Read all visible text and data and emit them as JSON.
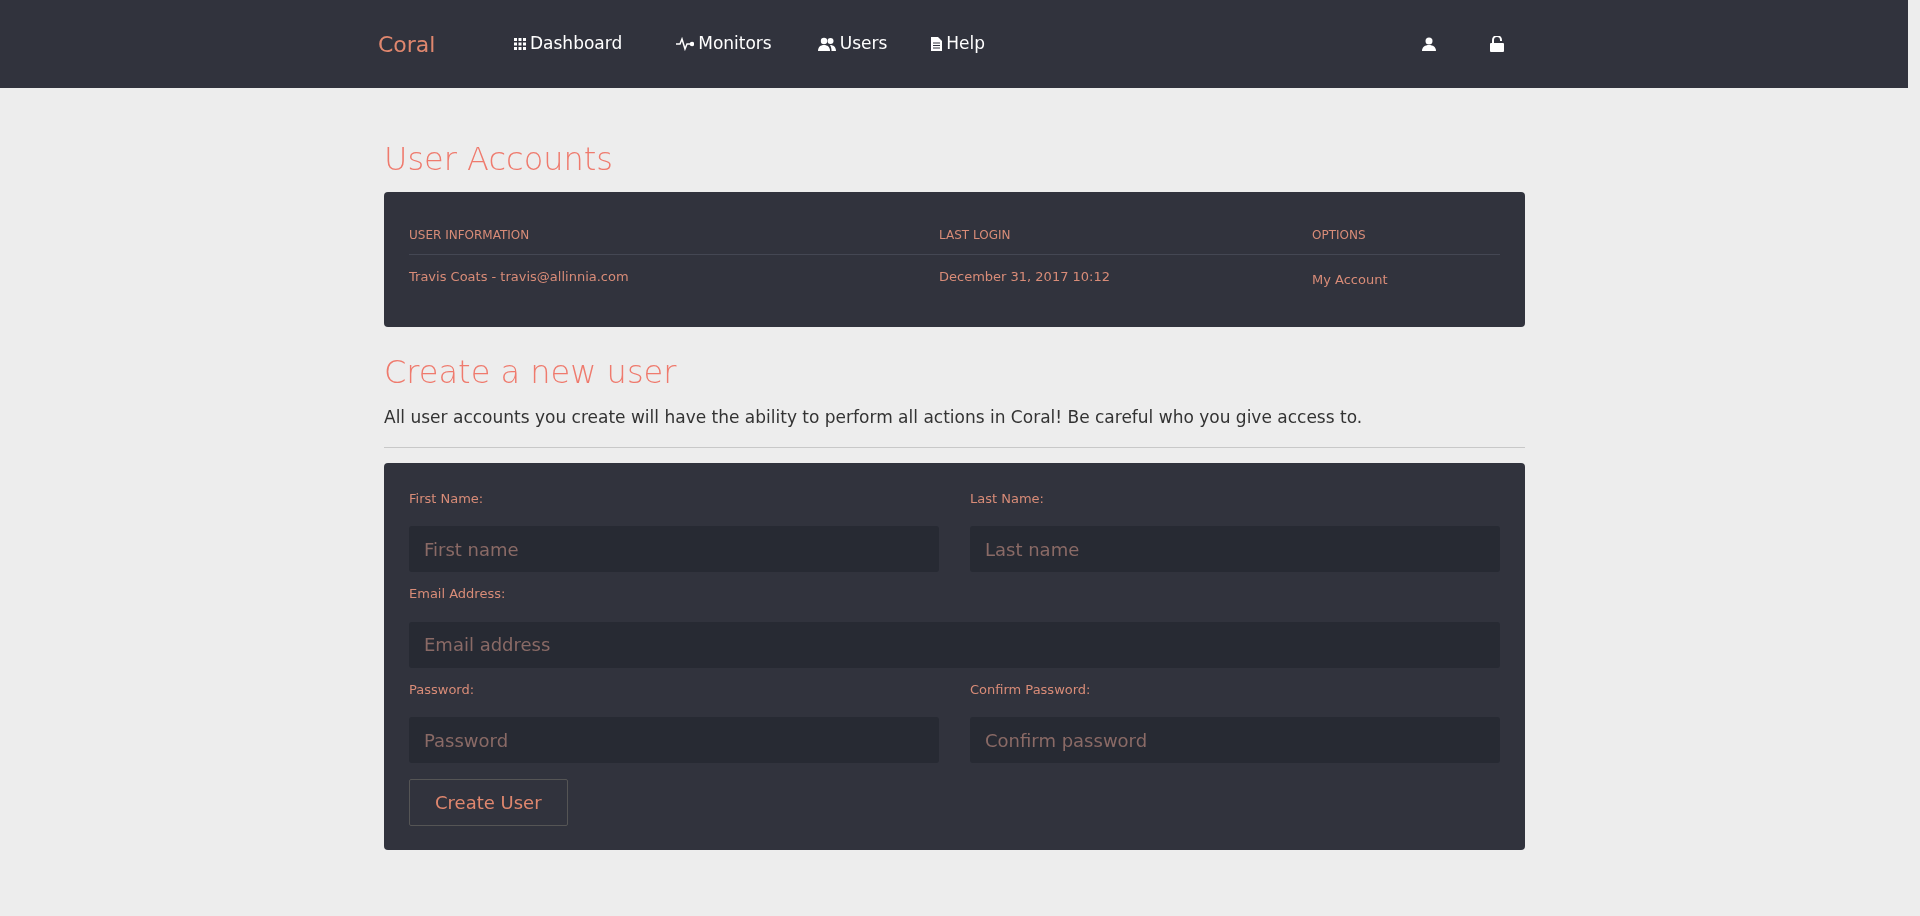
{
  "navbar": {
    "brand": "Coral",
    "links": [
      {
        "kind": "grid",
        "label": "Dashboard"
      },
      {
        "kind": "pulse",
        "label": "Monitors"
      },
      {
        "kind": "users",
        "label": "Users"
      },
      {
        "kind": "file",
        "label": "Help"
      }
    ],
    "icons": [
      {
        "kind": "user"
      },
      {
        "kind": "lock"
      }
    ]
  },
  "accounts": {
    "title": "User Accounts",
    "columns": [
      "USER INFORMATION",
      "LAST LOGIN",
      "OPTIONS"
    ],
    "rows": [
      {
        "user": "Travis Coats - travis@allinnia.com",
        "last_login": "December 31, 2017 10:12",
        "option": "My Account"
      }
    ]
  },
  "create": {
    "title": "Create a new user",
    "description": "All user accounts you create will have the ability to perform all actions in Coral! Be careful who you give access to.",
    "rows": [
      [
        {
          "label": "First Name:",
          "placeholder": "First name"
        },
        {
          "label": "Last Name:",
          "placeholder": "Last name"
        }
      ],
      [
        {
          "label": "Email Address:",
          "placeholder": "Email address"
        }
      ],
      [
        {
          "label": "Password:",
          "placeholder": "Password"
        },
        {
          "label": "Confirm Password:",
          "placeholder": "Confirm password"
        }
      ]
    ],
    "button": "Create User"
  }
}
